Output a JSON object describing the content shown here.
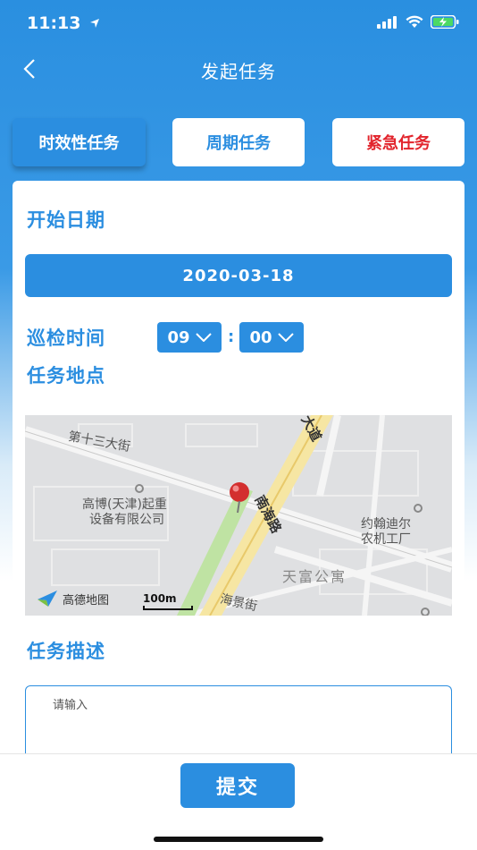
{
  "status": {
    "time": "11:13"
  },
  "nav": {
    "title": "发起任务"
  },
  "tabs": [
    {
      "label": "时效性任务",
      "selected": true,
      "color": "#2b8ee0"
    },
    {
      "label": "周期任务",
      "selected": false,
      "color": "#2b8ee0"
    },
    {
      "label": "紧急任务",
      "selected": false,
      "color": "#e2252d"
    }
  ],
  "form": {
    "start_date_label": "开始日期",
    "start_date_value": "2020-03-18",
    "patrol_time_label": "巡检时间",
    "hour": "09",
    "minute": "00",
    "location_label": "任务地点",
    "description_label": "任务描述",
    "description_placeholder": "请输入"
  },
  "map": {
    "labels": {
      "street1": "第十三大街",
      "company1_line1": "高博(天津)起重",
      "company1_line2": "设备有限公司",
      "road_south_sea": "南海路",
      "road_top": "大道",
      "company2_line1": "约翰迪尔",
      "company2_line2": "农机工厂",
      "apartment": "天富公寓",
      "street2": "海景街"
    },
    "provider": "高德地图",
    "scale": "100m"
  },
  "submit_label": "提交",
  "colors": {
    "primary": "#2b8ee0",
    "urgent": "#e2252d"
  }
}
